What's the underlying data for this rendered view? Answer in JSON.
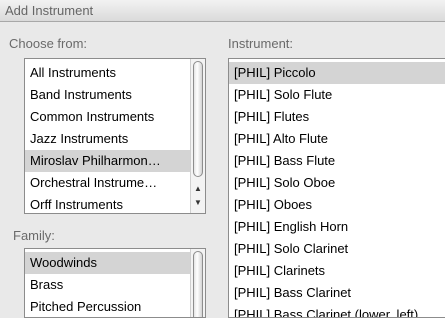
{
  "window": {
    "title": "Add Instrument"
  },
  "choose_from": {
    "label": "Choose from:",
    "items": [
      "All Instruments",
      "Band Instruments",
      "Common Instruments",
      "Jazz Instruments",
      "Miroslav Philharmon…",
      "Orchestral Instrume…",
      "Orff Instruments"
    ],
    "selected_index": 4
  },
  "family": {
    "label": "Family:",
    "items": [
      "Woodwinds",
      "Brass",
      "Pitched Percussion"
    ],
    "selected_index": 0
  },
  "instrument": {
    "label": "Instrument:",
    "items": [
      "[PHIL] Piccolo",
      "[PHIL] Solo Flute",
      "[PHIL] Flutes",
      "[PHIL] Alto Flute",
      "[PHIL] Bass Flute",
      "[PHIL] Solo Oboe",
      "[PHIL] Oboes",
      "[PHIL] English Horn",
      "[PHIL] Solo Clarinet",
      "[PHIL] Clarinets",
      "[PHIL] Bass Clarinet",
      "[PHIL] Bass Clarinet (lower, left)"
    ],
    "selected_index": 0
  }
}
